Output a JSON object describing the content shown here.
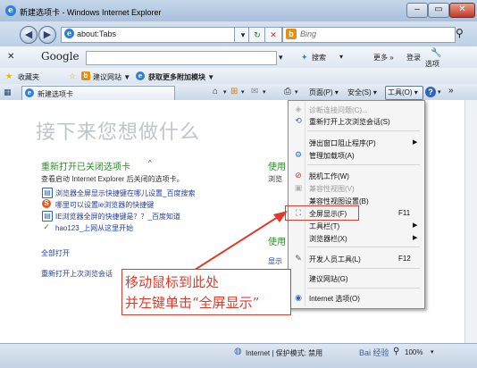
{
  "window": {
    "title": "新建选项卡 - Windows Internet Explorer"
  },
  "nav": {
    "address": "about:Tabs",
    "search_placeholder": "Bing"
  },
  "google_bar": {
    "logo": "Google",
    "search_btn": "搜索",
    "more": "更多 »",
    "login": "登录",
    "options": "选项"
  },
  "favorites": {
    "label": "收藏夹",
    "suggested": "建议网站 ▼",
    "gallery": "获取更多附加模块 ▼"
  },
  "tabs": [
    {
      "label": "新建选项卡"
    }
  ],
  "commands": {
    "page": "页面(P) ▾",
    "safety": "安全(S) ▾",
    "tools": "工具(O) ▾"
  },
  "content": {
    "big_title": "接下来您想做什么",
    "reopen_title": "重新打开已关闭选项卡",
    "reopen_desc": "查看启动 Internet Explorer 后关闭的选项卡。",
    "closed_tabs": [
      "浏览器全屏显示快捷键在哪儿设置_百度搜索",
      "哪里可以设置ie浏览器的快捷键",
      "IE浏览器全屏的快捷键是？？_百度知道",
      "hao123_上网从这里开始"
    ],
    "open_all": "全部打开",
    "reopen_last": "重新打开上次浏览会话",
    "right_title_1": "使用",
    "right_text_1": "浏览",
    "right_title_2": "使用",
    "right_text_2": "显示"
  },
  "tools_menu": {
    "items": [
      {
        "label": "诊断连接问题(C)...",
        "disabled": true
      },
      {
        "label": "重新打开上次浏览会话(S)"
      },
      {
        "label": "弹出窗口阻止程序(P)",
        "submenu": true
      },
      {
        "label": "管理加载项(A)"
      },
      {
        "label": "脱机工作(W)"
      },
      {
        "label": "兼容性视图(V)",
        "disabled": true
      },
      {
        "label": "兼容性视图设置(B)"
      },
      {
        "label": "全屏显示(F)",
        "shortcut": "F11",
        "highlighted": true
      },
      {
        "label": "工具栏(T)",
        "submenu": true
      },
      {
        "label": "浏览器栏(X)",
        "submenu": true
      },
      {
        "label": "开发人员工具(L)",
        "shortcut": "F12"
      },
      {
        "label": "建议网站(G)"
      },
      {
        "label": "Internet 选项(O)"
      }
    ]
  },
  "annotation": {
    "line1": "移动鼠标到此处",
    "line2": "并左键单击“全屏显示”",
    "color": "#e03a2a"
  },
  "status": {
    "zone": "Internet | 保护模式: 禁用",
    "zoom": "100%"
  },
  "watermark": "Bai 经验"
}
